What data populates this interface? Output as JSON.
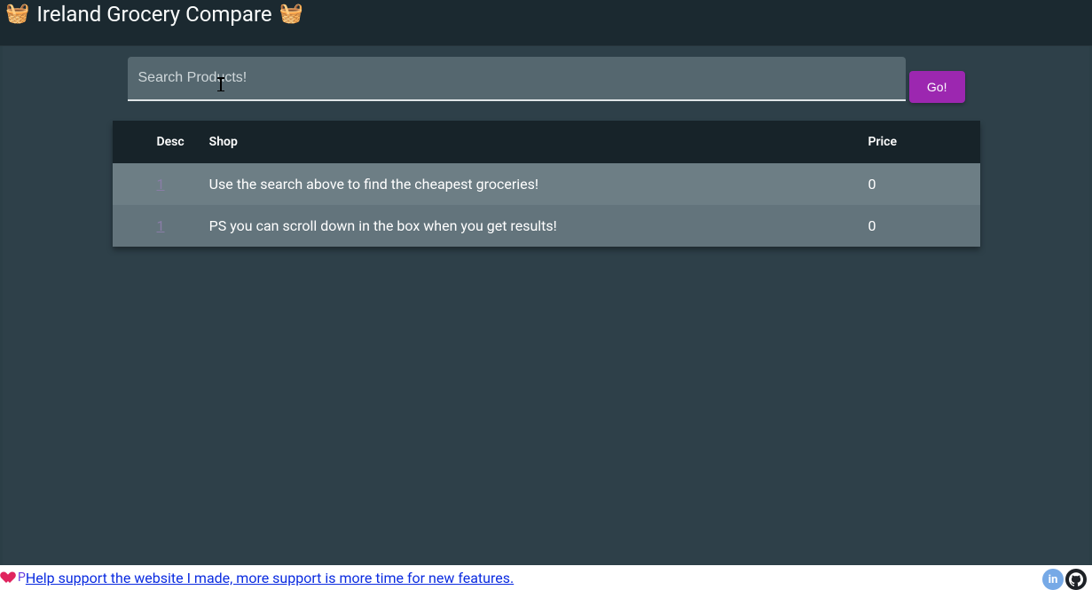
{
  "header": {
    "title": "Ireland Grocery Compare",
    "left_emoji": "🧺",
    "right_emoji": "🧺"
  },
  "search": {
    "placeholder": "Search Products!",
    "value": "",
    "button_label": "Go!"
  },
  "table": {
    "columns": {
      "desc": "Desc",
      "shop": "Shop",
      "price": "Price"
    },
    "rows": [
      {
        "desc_link": "1",
        "shop": "Use the search above to find the cheapest groceries!",
        "price": "0"
      },
      {
        "desc_link": "1",
        "shop": "PS you can scroll down in the box when you get results!",
        "price": "0"
      }
    ]
  },
  "footer": {
    "support_link": "Help support the website I made, more support is more time for new features.",
    "purple_prefix": "P"
  },
  "colors": {
    "accent": "#9c27b0",
    "header_bg": "#1b2930",
    "body_bg": "#2e4049",
    "thead_bg": "#172329",
    "row_bg": "#6d7e85",
    "row_alt_bg": "#63747c"
  }
}
